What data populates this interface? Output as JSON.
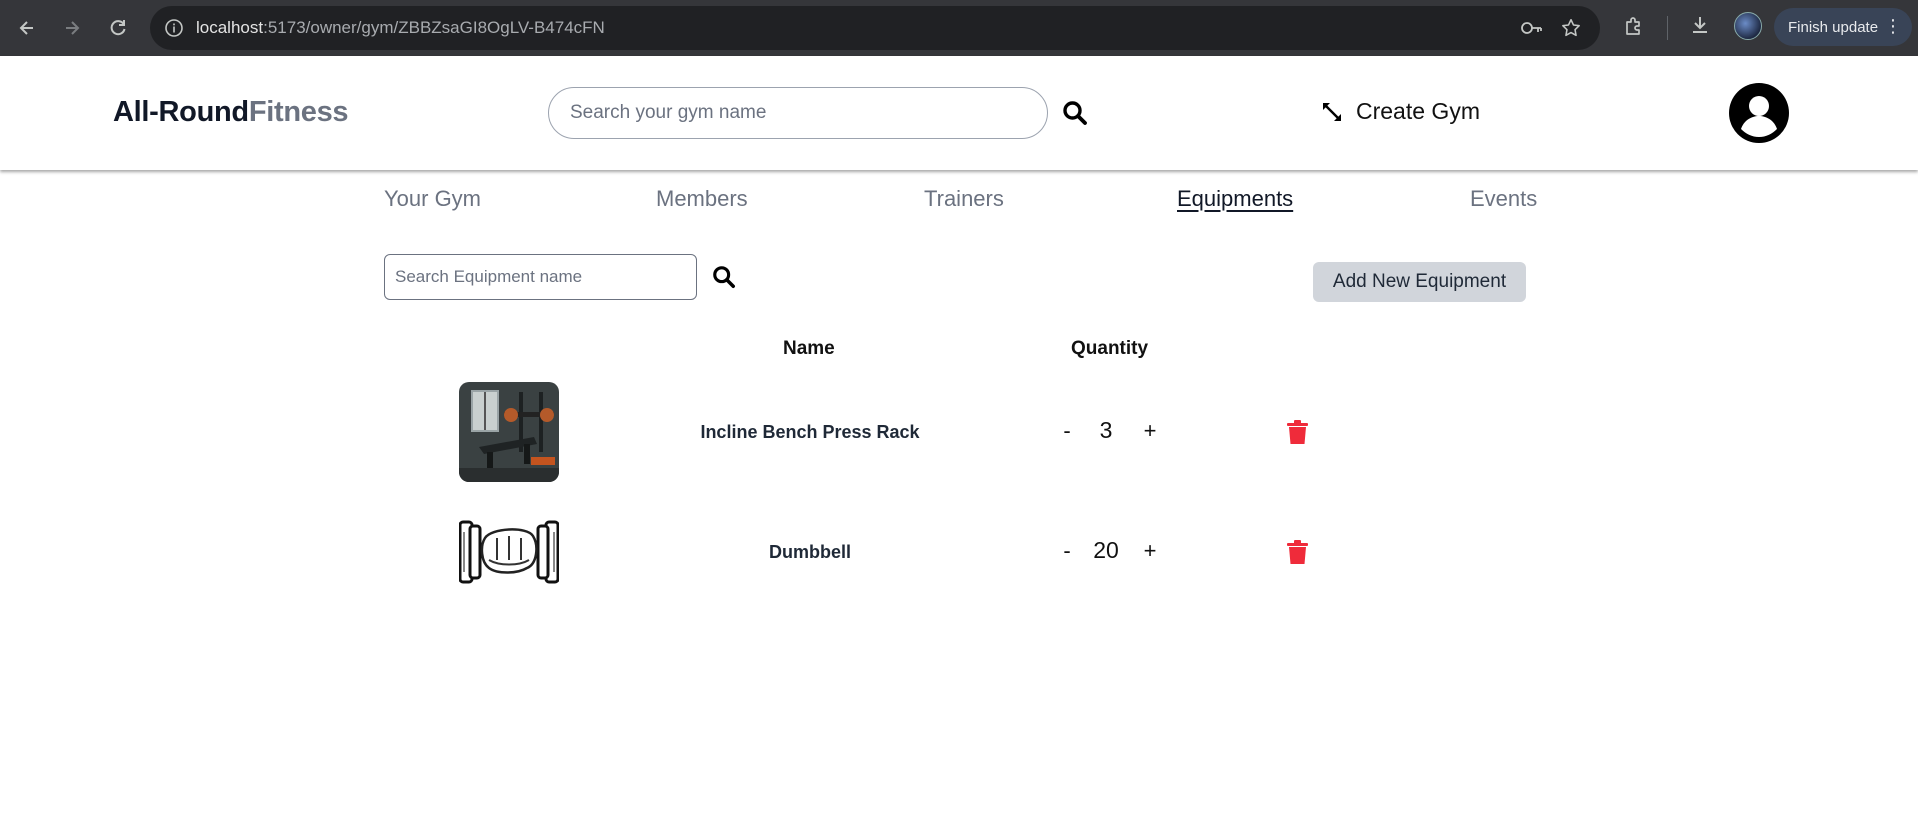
{
  "browser": {
    "url_host": "localhost",
    "url_path": ":5173/owner/gym/ZBBZsaGI8OgLV-B474cFN",
    "finish_update_label": "Finish update"
  },
  "header": {
    "logo_part1": "All-Round",
    "logo_part2": "Fitness",
    "search_placeholder": "Search your gym name",
    "create_gym_label": "Create Gym"
  },
  "tabs": [
    {
      "label": "Your Gym",
      "active": false
    },
    {
      "label": "Members",
      "active": false
    },
    {
      "label": "Trainers",
      "active": false
    },
    {
      "label": "Equipments",
      "active": true
    },
    {
      "label": "Events",
      "active": false
    }
  ],
  "equipment": {
    "search_placeholder": "Search Equipment name",
    "add_button_label": "Add New Equipment",
    "columns": {
      "name": "Name",
      "quantity": "Quantity"
    },
    "items": [
      {
        "name": "Incline Bench Press Rack",
        "quantity": "3",
        "minus": "-",
        "plus": "+"
      },
      {
        "name": "Dumbbell",
        "quantity": "20",
        "minus": "-",
        "plus": "+"
      }
    ]
  },
  "colors": {
    "trash": "#ef2b3a",
    "add_button_bg": "#d1d5db",
    "logo_secondary": "#6b7280"
  }
}
